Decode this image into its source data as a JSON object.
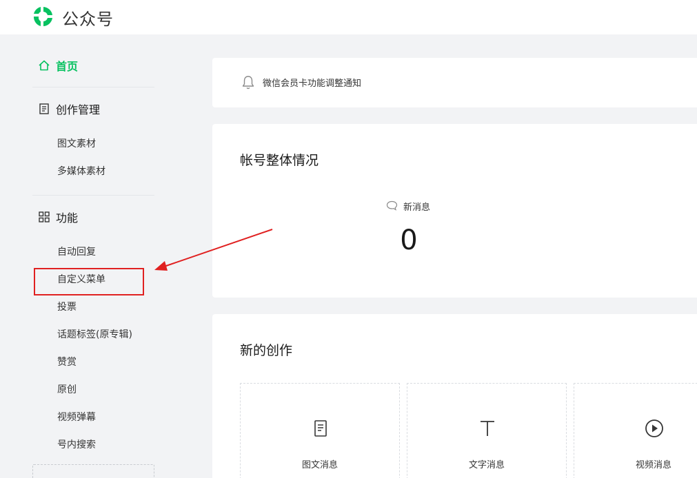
{
  "header": {
    "brand": "公众号",
    "logo_icon": "wechat-mp-logo-icon"
  },
  "sidebar": {
    "home": {
      "label": "首页",
      "icon": "home-icon"
    },
    "creation": {
      "label": "创作管理",
      "icon": "document-icon",
      "items": [
        "图文素材",
        "多媒体素材"
      ]
    },
    "features": {
      "label": "功能",
      "icon": "grid-icon",
      "items": [
        "自动回复",
        "自定义菜单",
        "投票",
        "话题标签(原专辑)",
        "赞赏",
        "原创",
        "视频弹幕",
        "号内搜索"
      ]
    }
  },
  "notice": {
    "icon": "bell-icon",
    "text": "微信会员卡功能调整通知"
  },
  "overview": {
    "title": "帐号整体情况",
    "new_messages": {
      "icon": "chat-bubble-icon",
      "label": "新消息",
      "value": "0"
    }
  },
  "create": {
    "title": "新的创作",
    "tiles": [
      {
        "label": "图文消息",
        "icon": "article-icon"
      },
      {
        "label": "文字消息",
        "icon": "text-icon"
      },
      {
        "label": "视频消息",
        "icon": "play-circle-icon"
      }
    ]
  },
  "colors": {
    "accent": "#07c160",
    "annotation": "#e02020",
    "background": "#f2f3f5"
  }
}
